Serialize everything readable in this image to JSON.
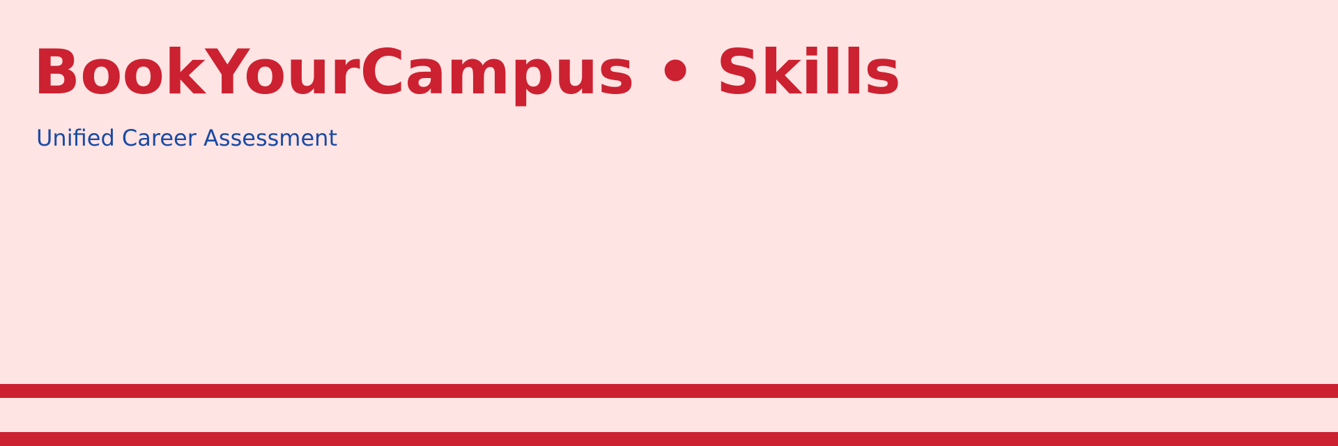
{
  "header": {
    "title": "BookYourCampus • Skills",
    "subtitle": "Unified Career Assessment"
  },
  "colors": {
    "background": "#ffe4e4",
    "brand_red": "#cc2130",
    "subtitle_blue": "#1a4aa3"
  }
}
